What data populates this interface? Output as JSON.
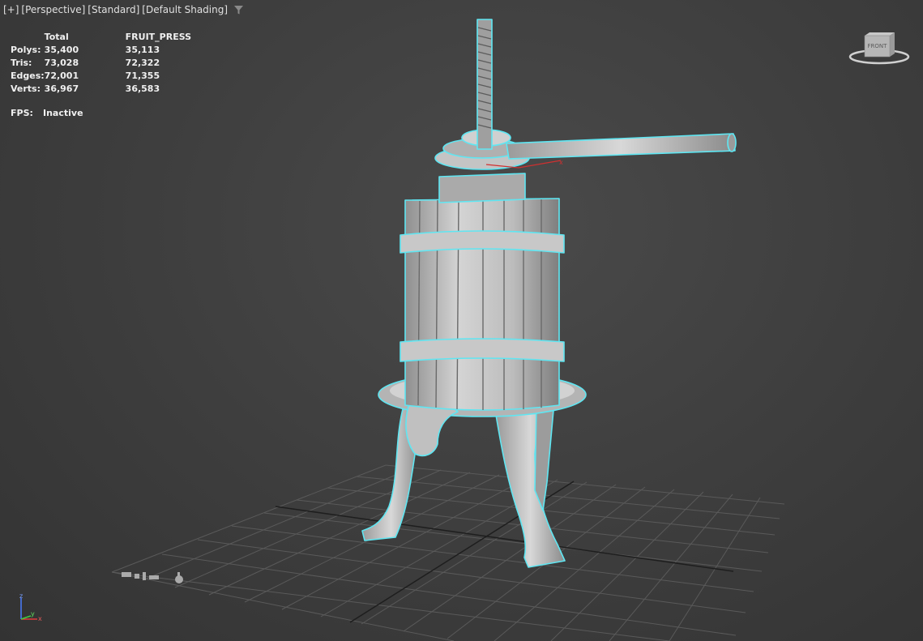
{
  "viewport": {
    "menu": {
      "plus": "[+]",
      "view": "[Perspective]",
      "mode": "[Standard]",
      "shading": "[Default Shading]",
      "filter_icon": "funnel-filter-icon"
    },
    "stats": {
      "header_total": "Total",
      "header_object": "FRUIT_PRESS",
      "rows": [
        {
          "label": "Polys:",
          "total": "35,400",
          "object": "35,113"
        },
        {
          "label": "Tris:",
          "total": "73,028",
          "object": "72,322"
        },
        {
          "label": "Edges:",
          "total": "72,001",
          "object": "71,355"
        },
        {
          "label": "Verts:",
          "total": "36,967",
          "object": "36,583"
        }
      ],
      "fps_label": "FPS:",
      "fps_value": "Inactive"
    },
    "viewcube": {
      "face_label": "FRONT"
    },
    "axis": {
      "z": "z",
      "x": "x",
      "y": "y"
    },
    "selection_color": "#5fe6f2",
    "background_color": "#3d3d3d"
  }
}
